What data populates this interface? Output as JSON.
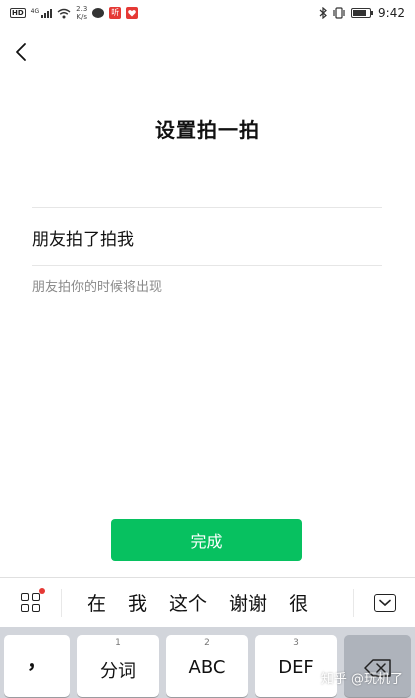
{
  "status_bar": {
    "hd_label": "HD",
    "network_label": "4G",
    "speed_value": "2.3",
    "speed_unit": "K/s",
    "app_badge_label": "听",
    "time": "9:42"
  },
  "header": {
    "title": "设置拍一拍"
  },
  "form": {
    "input_value": "朋友拍了拍我",
    "hint": "朋友拍你的时候将出现"
  },
  "actions": {
    "done_label": "完成"
  },
  "candidate_bar": {
    "words": [
      "在",
      "我",
      "这个",
      "谢谢",
      "很"
    ]
  },
  "keyboard": {
    "keys": [
      {
        "number": "",
        "label": "，"
      },
      {
        "number": "1",
        "label": "分词"
      },
      {
        "number": "2",
        "label": "ABC"
      },
      {
        "number": "3",
        "label": "DEF"
      }
    ]
  },
  "watermark": "知乎 @玩机了",
  "colors": {
    "accent": "#07c160",
    "background": "#ffffff",
    "keyboard_bg": "#d2d5db"
  },
  "icons": [
    "back-icon",
    "grid-icon",
    "collapse-keyboard-icon",
    "delete-icon"
  ]
}
